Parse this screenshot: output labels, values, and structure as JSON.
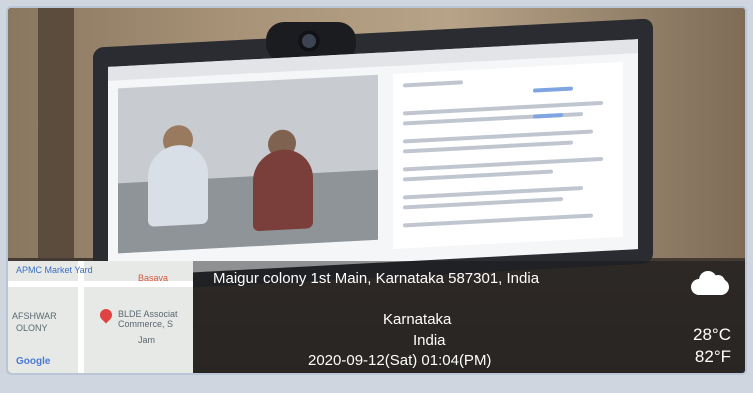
{
  "map": {
    "labels": [
      "APMC Market Yard",
      "Basava",
      "AFSHWAR",
      "OLONY",
      "BLDE Associat",
      "Commerce, S",
      "Jam"
    ],
    "logo": "Google"
  },
  "location": {
    "address": "Maigur colony 1st Main, Karnataka 587301, India",
    "state": "Karnataka",
    "country": "India"
  },
  "datetime": "2020-09-12(Sat)  01:04(PM)",
  "weather": {
    "icon": "cloud-icon",
    "temp_c": "28°C",
    "temp_f": "82°F"
  }
}
